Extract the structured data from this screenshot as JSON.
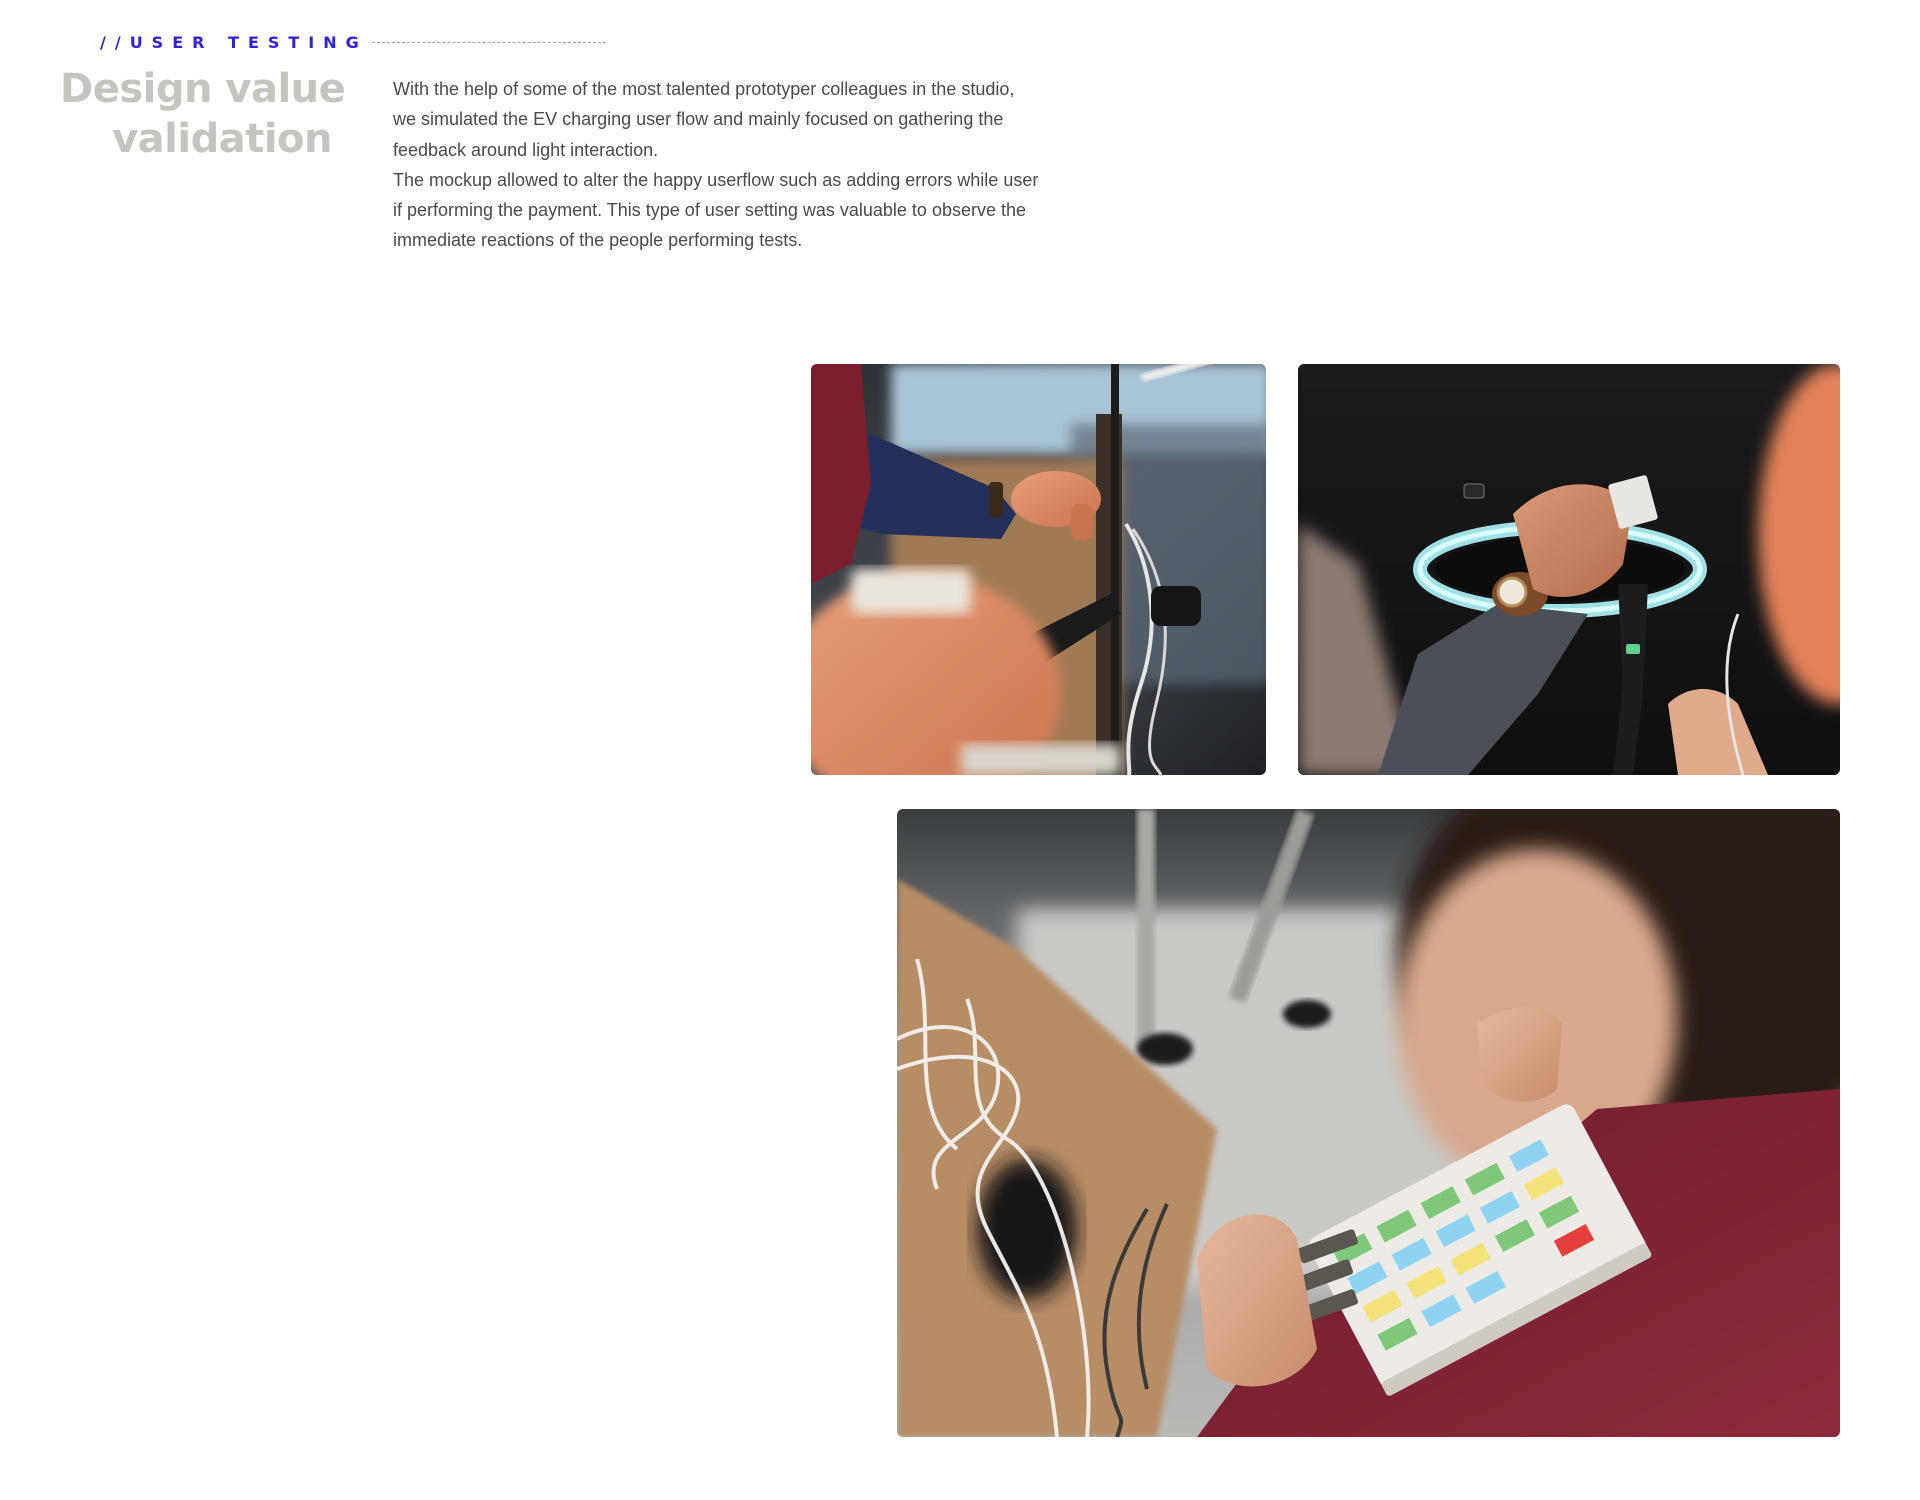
{
  "section": {
    "eyebrow": "//USER TESTING",
    "title_line_1": "Design value",
    "title_line_2": "validation"
  },
  "body": {
    "lines": [
      "With the help of some of the most talented prototyper colleagues in the studio,",
      "we simulated the EV charging user flow and mainly focused on gathering the",
      "feedback around light interaction.",
      "The mockup allowed to alter the happy userflow such as adding errors while user",
      "if performing the payment. This type of user setting was valuable to observe the",
      "immediate reactions of the people performing tests."
    ]
  },
  "colors": {
    "accent": "#2f1fe0",
    "title": "#c5c5c0",
    "body_text": "#4a4a4a"
  }
}
